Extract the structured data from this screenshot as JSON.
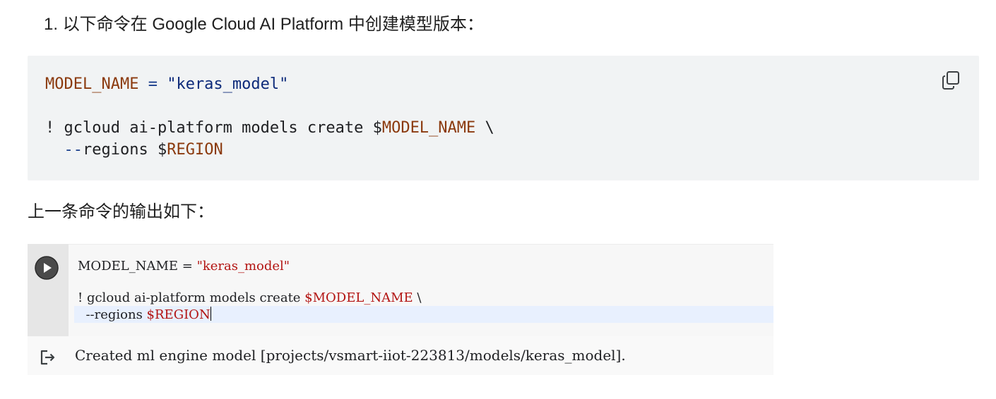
{
  "step": {
    "number": "1.",
    "text": "以下命令在 Google Cloud AI Platform 中创建模型版本："
  },
  "code_block": {
    "line1": {
      "var": "MODEL_NAME",
      "op": " = ",
      "str": "\"keras_model\""
    },
    "line3": {
      "prefix": "! gcloud ai-platform models create $",
      "var": "MODEL_NAME",
      "suffix": " \\"
    },
    "line4": {
      "indent": "  ",
      "flag": "--",
      "mid": "regions $",
      "var": "REGION"
    },
    "copy_icon": "copy-icon"
  },
  "caption": "上一条命令的输出如下：",
  "notebook": {
    "run_icon": "play-circle-icon",
    "line1": {
      "var": "MODEL_NAME",
      "op": " = ",
      "str": "\"keras_model\""
    },
    "line3": {
      "prefix": "! gcloud ai-platform models create ",
      "var": "$MODEL_NAME",
      "suffix": " \\"
    },
    "line4": {
      "prefix": "  --regions ",
      "var": "$REGION"
    },
    "output_icon": "output-arrow-icon",
    "output_text": "Created ml engine model [projects/vsmart-iiot-223813/models/keras_model]."
  },
  "colors": {
    "code_bg": "#f1f3f4",
    "code_var": "#8b3a0e",
    "code_str": "#0d2a7a",
    "nb_gutter": "#e6e6e6",
    "nb_accent": "#b31412",
    "active_line": "#e8f0fe"
  }
}
